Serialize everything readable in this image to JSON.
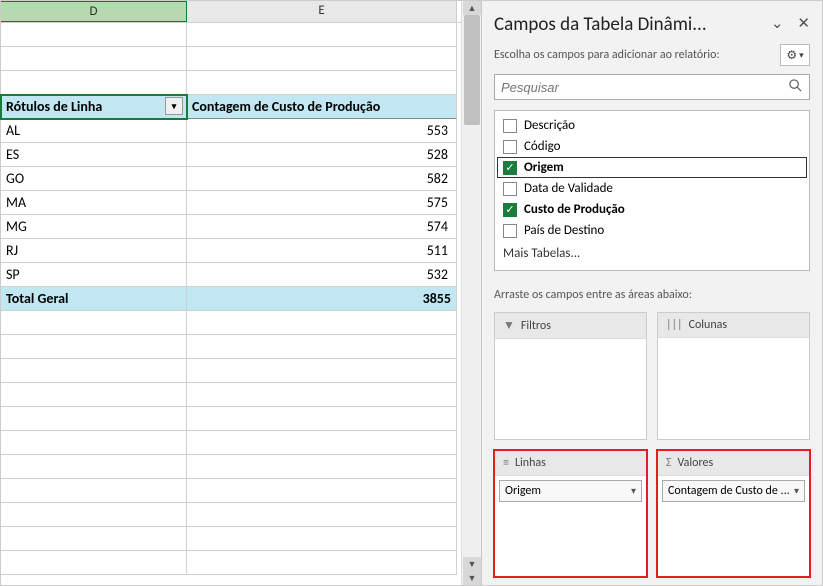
{
  "columns": {
    "d": "D",
    "e": "E"
  },
  "pivot": {
    "header_row_label": "Rótulos de Linha",
    "header_value_label": "Contagem de Custo de Produção",
    "rows": [
      {
        "label": "AL",
        "value": "553"
      },
      {
        "label": "ES",
        "value": "528"
      },
      {
        "label": "GO",
        "value": "582"
      },
      {
        "label": "MA",
        "value": "575"
      },
      {
        "label": "MG",
        "value": "574"
      },
      {
        "label": "RJ",
        "value": "511"
      },
      {
        "label": "SP",
        "value": "532"
      }
    ],
    "total_label": "Total Geral",
    "total_value": "3855"
  },
  "pane": {
    "title": "Campos da Tabela Dinâmi...",
    "subtitle": "Escolha os campos para adicionar ao relatório:",
    "search_placeholder": "Pesquisar",
    "fields": [
      {
        "label": "Descrição",
        "checked": false
      },
      {
        "label": "Código",
        "checked": false
      },
      {
        "label": "Origem",
        "checked": true,
        "selected": true
      },
      {
        "label": "Data de Validade",
        "checked": false
      },
      {
        "label": "Custo de Produção",
        "checked": true
      },
      {
        "label": "País de Destino",
        "checked": false
      }
    ],
    "more_tables": "Mais Tabelas...",
    "drag_hint": "Arraste os campos entre as áreas abaixo:",
    "areas": {
      "filters": "Filtros",
      "columns": "Colunas",
      "rows": "Linhas",
      "values": "Valores"
    },
    "rows_pill": "Origem",
    "values_pill": "Contagem de Custo de ..."
  }
}
